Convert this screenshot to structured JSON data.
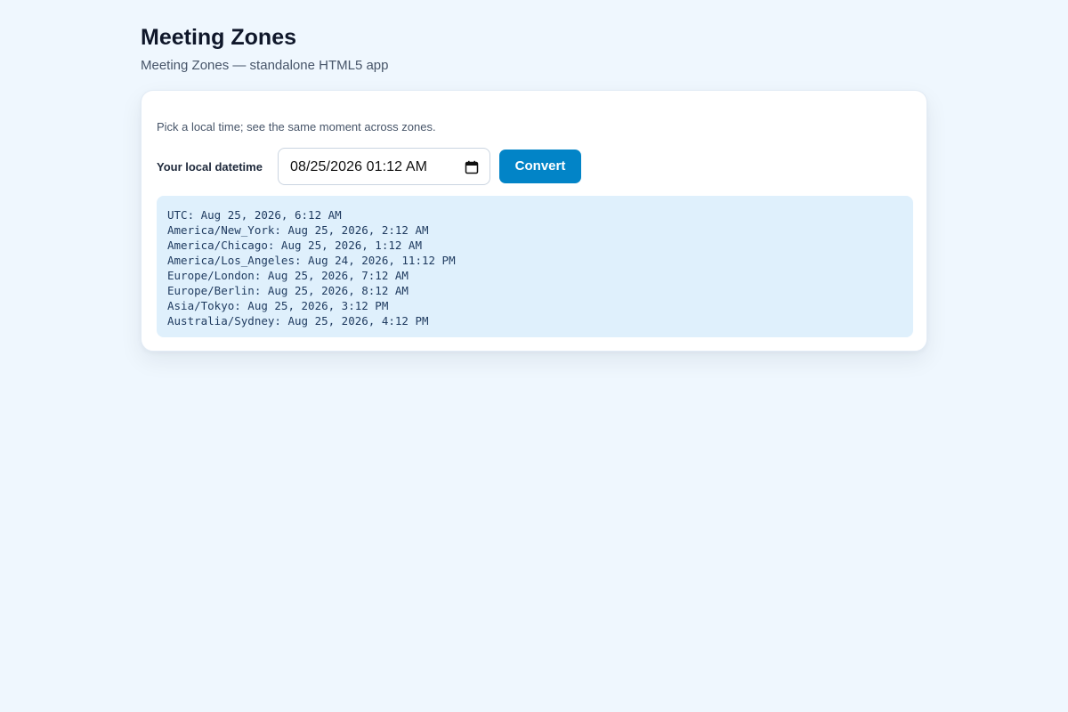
{
  "header": {
    "title": "Meeting Zones",
    "subtitle": "Meeting Zones — standalone HTML5 app"
  },
  "card": {
    "hint": "Pick a local time; see the same moment across zones.",
    "datetime_label": "Your local datetime",
    "datetime_value": "08/25/2026 01:12  AM",
    "calendar_icon": "calendar-icon",
    "convert_label": "Convert"
  },
  "results": [
    "UTC: Aug 25, 2026, 6:12 AM",
    "America/New_York: Aug 25, 2026, 2:12 AM",
    "America/Chicago: Aug 25, 2026, 1:12 AM",
    "America/Los_Angeles: Aug 24, 2026, 11:12 PM",
    "Europe/London: Aug 25, 2026, 7:12 AM",
    "Europe/Berlin: Aug 25, 2026, 8:12 AM",
    "Asia/Tokyo: Aug 25, 2026, 3:12 PM",
    "Australia/Sydney: Aug 25, 2026, 4:12 PM"
  ],
  "colors": {
    "background": "#eff7fe",
    "accent": "#0284c7",
    "results_background": "#dff0fc"
  }
}
